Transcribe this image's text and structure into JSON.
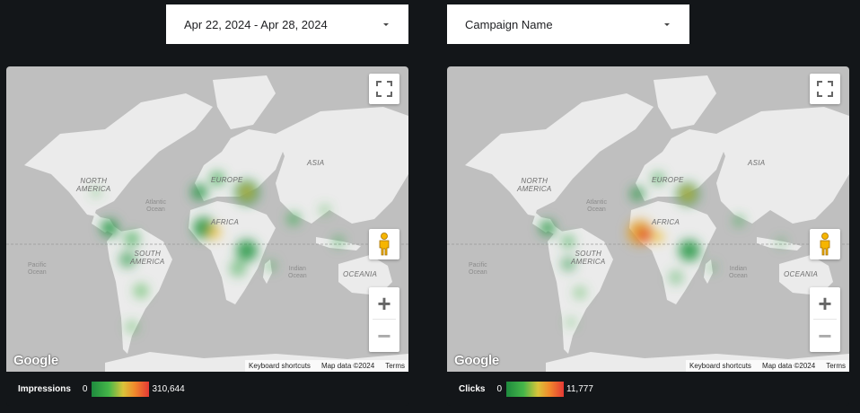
{
  "filters": {
    "date_range": "Apr 22, 2024 - Apr 28, 2024",
    "campaign": "Campaign Name"
  },
  "map_labels": {
    "north_america": "NORTH\nAMERICA",
    "south_america": "SOUTH\nAMERICA",
    "europe": "EUROPE",
    "africa": "AFRICA",
    "asia": "ASIA",
    "oceania": "OCEANIA",
    "atlantic": "Atlantic\nOcean",
    "pacific": "Pacific\nOcean",
    "indian": "Indian\nOcean"
  },
  "map_footer": {
    "google": "Google",
    "shortcuts": "Keyboard shortcuts",
    "map_data": "Map data ©2024",
    "terms": "Terms"
  },
  "panels": [
    {
      "metric": "Impressions",
      "min": "0",
      "max": "310,644"
    },
    {
      "metric": "Clicks",
      "min": "0",
      "max": "11,777"
    }
  ],
  "icons": [
    "chevron-down-icon",
    "fullscreen-icon",
    "pegman-icon",
    "zoom-in-icon",
    "zoom-out-icon"
  ],
  "colors": {
    "background": "#131619",
    "low": "#1e8a3e",
    "mid": "#f0c13a",
    "high": "#e53935"
  }
}
